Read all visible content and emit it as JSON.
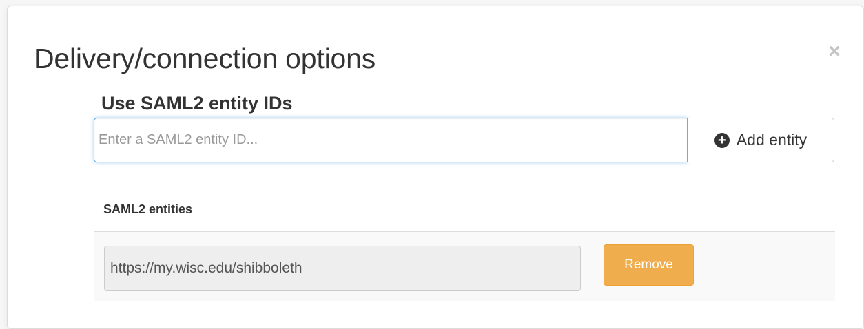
{
  "modal": {
    "title": "Delivery/connection options",
    "close_label": "×"
  },
  "saml": {
    "heading": "Use SAML2 entity IDs",
    "input_placeholder": "Enter a SAML2 entity ID...",
    "input_value": "",
    "add_button_label": "Add entity",
    "add_button_icon": "plus-circle-icon",
    "list_heading": "SAML2 entities",
    "entities": [
      {
        "value": "https://my.wisc.edu/shibboleth",
        "remove_label": "Remove"
      }
    ]
  },
  "colors": {
    "input_focus_border": "#66afe9",
    "remove_button": "#f0ad4e",
    "close_icon": "#c4c4c4"
  }
}
